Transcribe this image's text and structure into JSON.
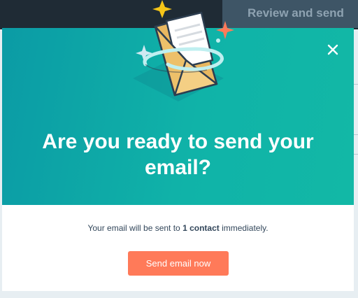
{
  "background": {
    "tab_label": "Review and send"
  },
  "modal": {
    "title": "Are you ready to send your email?",
    "body_prefix": "Your email will be sent to ",
    "body_count": "1 contact",
    "body_suffix": " immediately.",
    "primary_button": "Send email now",
    "close_icon": "close-icon"
  },
  "colors": {
    "hero_teal": "#10b3a8",
    "button_orange": "#ff7a59",
    "text_dark": "#33475b"
  }
}
